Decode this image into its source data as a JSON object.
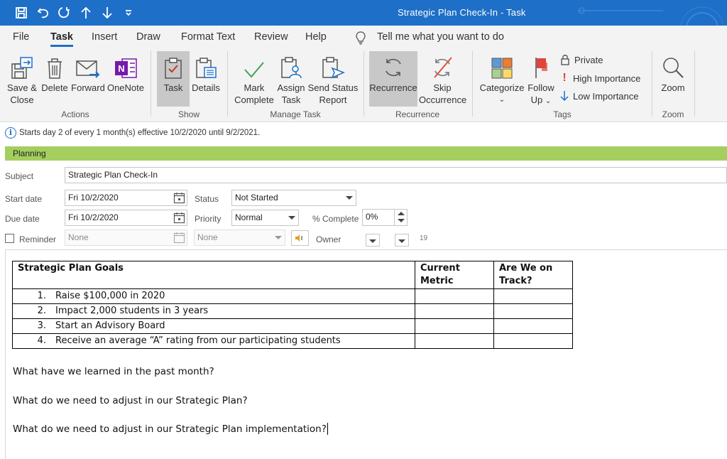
{
  "window": {
    "title": "Strategic Plan Check-In  -  Task"
  },
  "quick_access": [
    "save-icon",
    "undo-icon",
    "redo-icon",
    "up-arrow-icon",
    "down-arrow-icon",
    "customize-icon"
  ],
  "menu": {
    "tabs": [
      "File",
      "Task",
      "Insert",
      "Draw",
      "Format Text",
      "Review",
      "Help"
    ],
    "active": "Task",
    "tell_me": "Tell me what you want to do"
  },
  "ribbon": {
    "actions": {
      "save_close_1": "Save &",
      "save_close_2": "Close",
      "delete": "Delete",
      "forward": "Forward",
      "onenote": "OneNote",
      "label": "Actions"
    },
    "show": {
      "task": "Task",
      "details": "Details",
      "label": "Show"
    },
    "manage": {
      "mark_1": "Mark",
      "mark_2": "Complete",
      "assign_1": "Assign",
      "assign_2": "Task",
      "send_1": "Send Status",
      "send_2": "Report",
      "label": "Manage Task"
    },
    "recurrence": {
      "recurrence": "Recurrence",
      "skip_1": "Skip",
      "skip_2": "Occurrence",
      "label": "Recurrence"
    },
    "tags": {
      "categorize": "Categorize",
      "follow_1": "Follow",
      "follow_2": "Up",
      "private": "Private",
      "high": "High Importance",
      "low": "Low Importance",
      "label": "Tags"
    },
    "zoom": {
      "zoom": "Zoom",
      "label": "Zoom"
    }
  },
  "info": {
    "text": "Starts day 2 of every 1 month(s) effective 10/2/2020 until 9/2/2021."
  },
  "category": {
    "name": "Planning",
    "color": "#a4cf5f"
  },
  "form": {
    "subject_label": "Subject",
    "subject": "Strategic Plan Check-In",
    "start_label": "Start date",
    "start": "Fri 10/2/2020",
    "due_label": "Due date",
    "due": "Fri 10/2/2020",
    "status_label": "Status",
    "status": "Not Started",
    "priority_label": "Priority",
    "priority": "Normal",
    "complete_label": "% Complete",
    "complete": "0%",
    "reminder_label": "Reminder",
    "reminder_date": "None",
    "reminder_time": "None",
    "owner_label": "Owner",
    "owner_fragment": "19"
  },
  "body": {
    "table": {
      "headers": [
        "Strategic Plan Goals",
        "Current Metric",
        "Are We on Track?"
      ],
      "rows": [
        {
          "num": "1.",
          "goal": "Raise $100,000 in 2020"
        },
        {
          "num": "2.",
          "goal": "Impact 2,000 students in 3 years"
        },
        {
          "num": "3.",
          "goal": "Start an Advisory Board"
        },
        {
          "num": "4.",
          "goal": "Receive an average “A” rating from our participating students"
        }
      ]
    },
    "q1": "What have we learned in the past month?",
    "q2": "What do we need to adjust in our Strategic Plan?",
    "q3": "What do we need to adjust in our Strategic Plan implementation?"
  }
}
